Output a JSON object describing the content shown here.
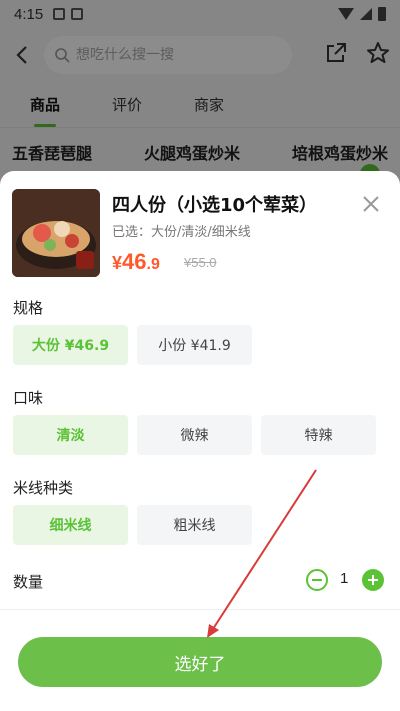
{
  "status_bar": {
    "time": "4:15"
  },
  "header": {
    "search_placeholder": "想吃什么搜一搜"
  },
  "tabs": [
    {
      "label": "商品"
    },
    {
      "label": "评价"
    },
    {
      "label": "商家"
    }
  ],
  "background_products": [
    "五香琵琶腿",
    "火腿鸡蛋炒米",
    "培根鸡蛋炒米"
  ],
  "sheet": {
    "title": "四人份（小选10个荤菜）",
    "selected_text": "已选：大份/清淡/细米线",
    "price_currency": "¥",
    "price_integer": "46",
    "price_decimal": ".9",
    "original_price": "¥55.0",
    "spec": {
      "label": "规格",
      "options": [
        {
          "label": "大份 ¥46.9",
          "selected": true
        },
        {
          "label": "小份 ¥41.9",
          "selected": false
        }
      ]
    },
    "taste": {
      "label": "口味",
      "options": [
        {
          "label": "清淡",
          "selected": true
        },
        {
          "label": "微辣",
          "selected": false
        },
        {
          "label": "特辣",
          "selected": false
        }
      ]
    },
    "noodle": {
      "label": "米线种类",
      "options": [
        {
          "label": "细米线",
          "selected": true
        },
        {
          "label": "粗米线",
          "selected": false
        }
      ]
    },
    "quantity": {
      "label": "数量",
      "value": "1"
    },
    "confirm_label": "选好了"
  },
  "colors": {
    "accent": "#5bc236",
    "price": "#ff5a2c",
    "annotation_arrow": "#d93a3a"
  }
}
